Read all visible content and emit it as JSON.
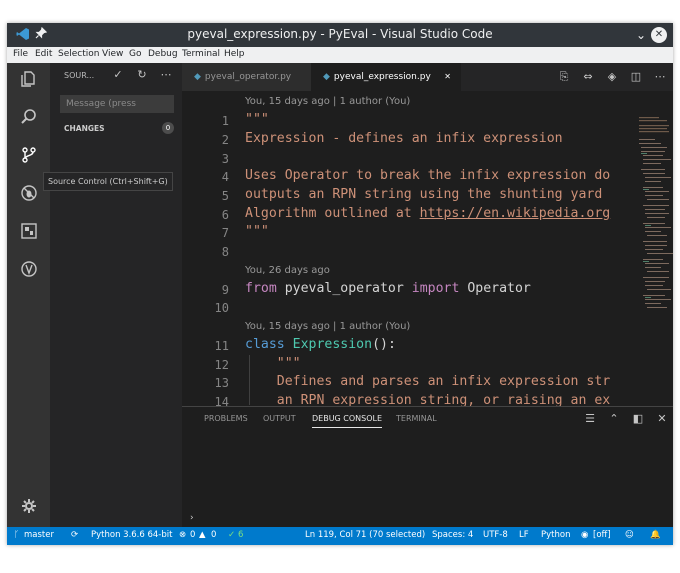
{
  "window": {
    "title": "pyeval_expression.py - PyEval - Visual Studio Code",
    "buttons": {
      "minimize": "⌄",
      "close": "✕"
    }
  },
  "menu": [
    "File",
    "Edit",
    "Selection",
    "View",
    "Go",
    "Debug",
    "Terminal",
    "Help"
  ],
  "activity_bar": {
    "tooltip": "Source Control (Ctrl+Shift+G)",
    "icons": [
      "explorer-icon",
      "search-icon",
      "source-control-icon",
      "debug-icon",
      "extensions-icon",
      "remote-icon",
      "gear-icon"
    ]
  },
  "sidebar": {
    "header": "SOUR...",
    "message_placeholder": "Message (press",
    "changes_label": "CHANGES",
    "changes_count": "0"
  },
  "tabs": [
    {
      "label": "pyeval_operator.py",
      "active": false
    },
    {
      "label": "pyeval_expression.py",
      "active": true,
      "close": "✕"
    }
  ],
  "editor": {
    "lens": [
      "You, 15 days ago | 1 author (You)",
      "You, 26 days ago",
      "You, 15 days ago | 1 author (You)"
    ],
    "line_numbers": [
      "1",
      "2",
      "3",
      "4",
      "5",
      "6",
      "7",
      "8",
      "9",
      "10",
      "11",
      "12",
      "13",
      "14"
    ],
    "lines": {
      "l1": "\"\"\"",
      "l2": "Expression - defines an infix expression",
      "l4": "Uses Operator to break the infix expression do",
      "l5": "outputs an RPN string using the shunting yard",
      "l6_text": "Algorithm outlined at ",
      "l6_link": "https://en.wikipedia.org",
      "l7": "\"\"\"",
      "l9_kw1": "from",
      "l9_mod": " pyeval_operator ",
      "l9_kw2": "import",
      "l9_name": " Operator",
      "l11_kw": "class",
      "l11_sp": " ",
      "l11_name": "Expression",
      "l11_rest": "():",
      "l12": "    \"\"\"",
      "l13": "    Defines and parses an infix expression str",
      "l14": "    an RPN expression string, or raising an ex"
    }
  },
  "panel": {
    "tabs": [
      "PROBLEMS",
      "OUTPUT",
      "DEBUG CONSOLE",
      "TERMINAL"
    ],
    "active_tab": "DEBUG CONSOLE",
    "prompt": "›"
  },
  "status": {
    "branch": "master",
    "sync": "⟳",
    "python": "Python 3.6.6 64-bit",
    "errors": "0",
    "warnings": "0",
    "tests": "6",
    "position": "Ln 119, Col 71 (70 selected)",
    "spaces": "Spaces: 4",
    "encoding": "UTF-8",
    "eol": "LF",
    "language": "Python",
    "liveshare": "[off]"
  },
  "colors": {
    "accent": "#007acc",
    "string": "#ce9178",
    "keyword": "#c586c0",
    "class_keyword": "#569cd6",
    "class_name": "#4ec9b0"
  }
}
